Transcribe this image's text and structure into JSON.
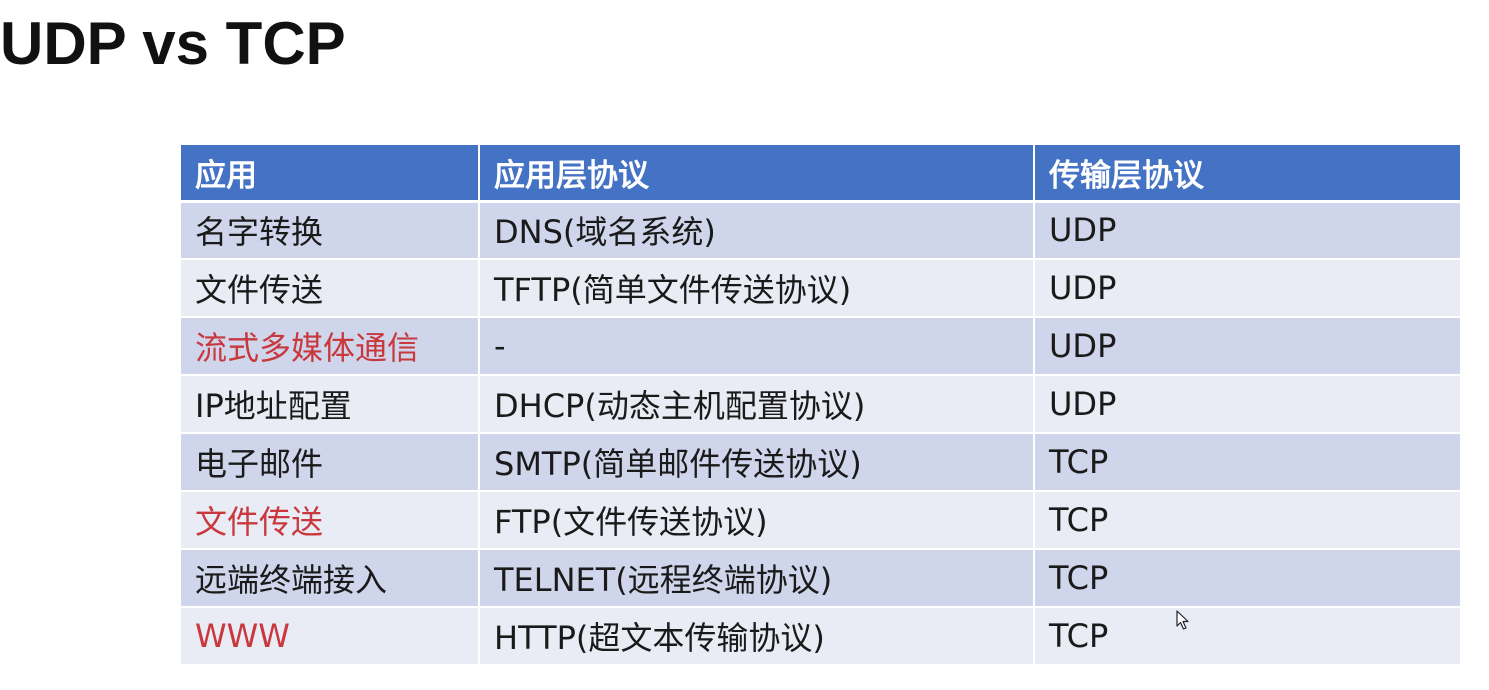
{
  "title": "UDP vs TCP",
  "table": {
    "headers": [
      "应用",
      "应用层协议",
      "传输层协议"
    ],
    "rows": [
      {
        "app": "名字转换",
        "app_highlight": false,
        "app_protocol": "DNS(域名系统)",
        "transport": "UDP"
      },
      {
        "app": "文件传送",
        "app_highlight": false,
        "app_protocol": "TFTP(简单文件传送协议)",
        "transport": "UDP"
      },
      {
        "app": "流式多媒体通信",
        "app_highlight": true,
        "app_protocol": "-",
        "transport": "UDP"
      },
      {
        "app": "IP地址配置",
        "app_highlight": false,
        "app_protocol": "DHCP(动态主机配置协议)",
        "transport": "UDP"
      },
      {
        "app": "电子邮件",
        "app_highlight": false,
        "app_protocol": "SMTP(简单邮件传送协议)",
        "transport": "TCP"
      },
      {
        "app": "文件传送",
        "app_highlight": true,
        "app_protocol": "FTP(文件传送协议)",
        "transport": "TCP"
      },
      {
        "app": "远端终端接入",
        "app_highlight": false,
        "app_protocol": "TELNET(远程终端协议)",
        "transport": "TCP"
      },
      {
        "app": "WWW",
        "app_highlight": true,
        "app_protocol": "HTTP(超文本传输协议)",
        "transport": "TCP"
      }
    ]
  },
  "colors": {
    "header_bg": "#4472c4",
    "row_odd": "#cfd5ea",
    "row_even": "#e9ebf5",
    "highlight_text": "#c8383c"
  },
  "cursor": {
    "icon": "mouse-pointer-icon"
  }
}
